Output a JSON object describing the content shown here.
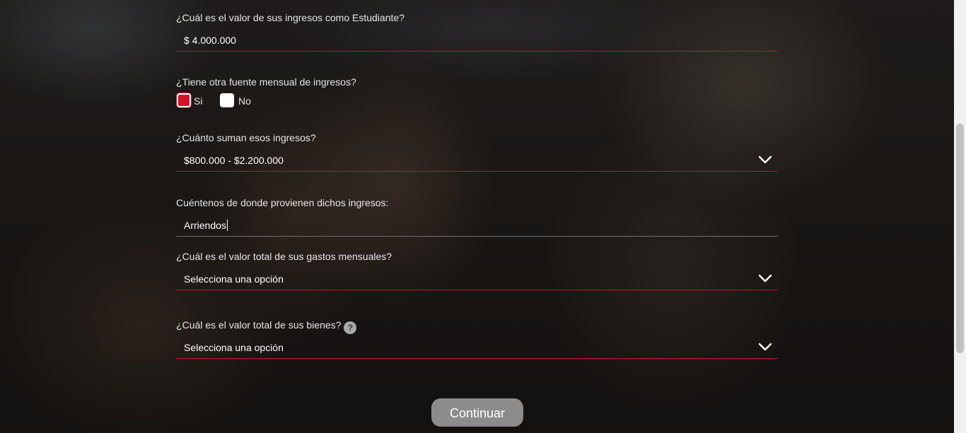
{
  "form": {
    "student_income": {
      "label": "¿Cuál es el valor de sus ingresos como Estudiante?",
      "value": "$ 4.000.000"
    },
    "other_income": {
      "label": "¿Tiene otra fuente mensual de ingresos?",
      "options": [
        {
          "label": "Si",
          "checked": true
        },
        {
          "label": "No",
          "checked": false
        }
      ]
    },
    "other_income_amount": {
      "label": "¿Cuánto suman esos ingresos?",
      "selected": "$800.000 - $2.200.000"
    },
    "income_source": {
      "label": "Cuéntenos de donde provienen dichos ingresos:",
      "value": "Arriendos"
    },
    "monthly_expenses": {
      "label": "¿Cuál es el valor total de sus gastos mensuales?",
      "selected": "Selecciona una opción"
    },
    "assets": {
      "label": "¿Cuál es el valor total de sus bienes?",
      "help_icon": "question-mark",
      "help_text": "?",
      "selected": "Selecciona una opción"
    },
    "submit_label": "Continuar"
  },
  "colors": {
    "accent": "#c8102e",
    "button": "#8c8c8c",
    "text": "#e7e7e7"
  }
}
